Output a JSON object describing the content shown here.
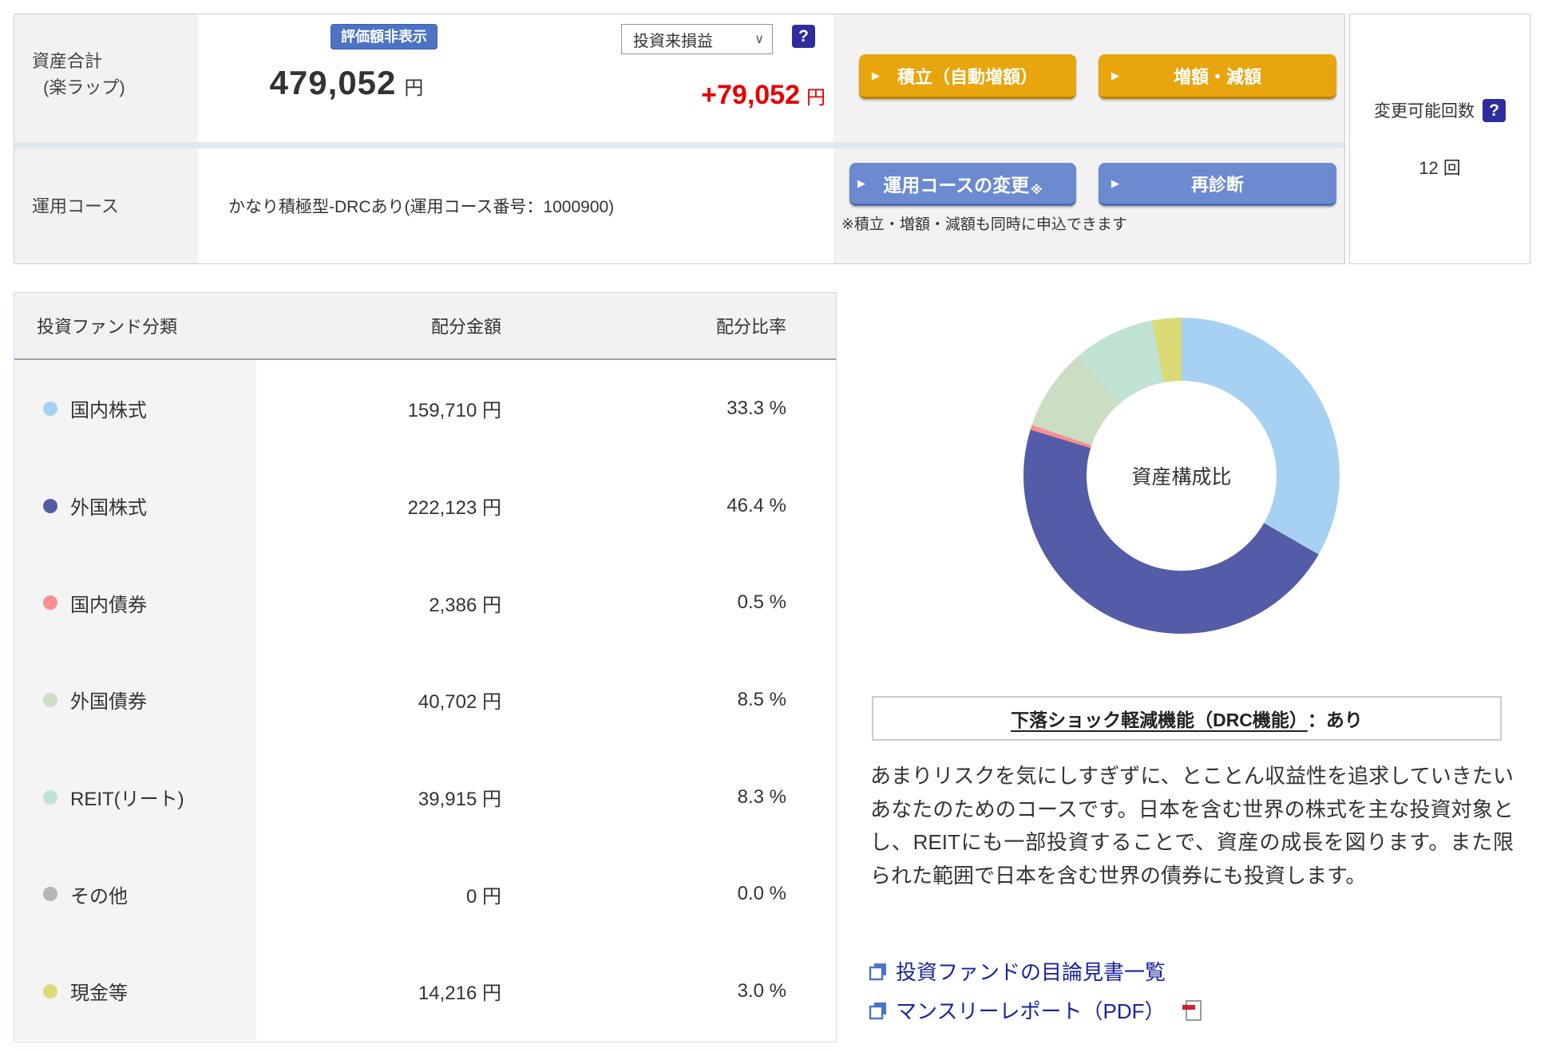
{
  "summary": {
    "asset_label": "資産合計",
    "asset_sublabel": "(楽ラップ)",
    "hide_badge": "評価額非表示",
    "total_value": "479,052",
    "total_unit": "円",
    "period_select_value": "投資来損益",
    "profit_value": "+79,052",
    "profit_unit": "円",
    "tsumitate_button": "積立（自動増額）",
    "zougaku_button": "増額・減額",
    "course_label": "運用コース",
    "course_value": "かなり積極型-DRCあり(運用コース番号：1000900)",
    "course_change_button": "運用コースの変更",
    "course_change_mark": "※",
    "rediagnosis_button": "再診断",
    "note": "※積立・増額・減額も同時に申込できます",
    "change_count_label": "変更可能回数",
    "change_count_value": "12 回"
  },
  "allocation": {
    "headers": {
      "category": "投資ファンド分類",
      "amount": "配分金額",
      "ratio": "配分比率"
    },
    "rows": [
      {
        "label": "国内株式",
        "amount": "159,710 円",
        "ratio": "33.3 %",
        "percent": 33.3,
        "color": "#a7d1f2"
      },
      {
        "label": "外国株式",
        "amount": "222,123 円",
        "ratio": "46.4 %",
        "percent": 46.4,
        "color": "#545ca8"
      },
      {
        "label": "国内債券",
        "amount": "2,386 円",
        "ratio": "0.5 %",
        "percent": 0.5,
        "color": "#f9908f"
      },
      {
        "label": "外国債券",
        "amount": "40,702 円",
        "ratio": "8.5 %",
        "percent": 8.5,
        "color": "#cbdec3"
      },
      {
        "label": "REIT(リート)",
        "amount": "39,915 円",
        "ratio": "8.3 %",
        "percent": 8.3,
        "color": "#bfe2d2"
      },
      {
        "label": "その他",
        "amount": "0 円",
        "ratio": "0.0 %",
        "percent": 0.0,
        "color": "#b5b5b5"
      },
      {
        "label": "現金等",
        "amount": "14,216 円",
        "ratio": "3.0 %",
        "percent": 3.0,
        "color": "#dcd977"
      }
    ]
  },
  "chart": {
    "center_label": "資産構成比"
  },
  "chart_data": {
    "type": "pie",
    "title": "資産構成比",
    "categories": [
      "国内株式",
      "外国株式",
      "国内債券",
      "外国債券",
      "REIT(リート)",
      "その他",
      "現金等"
    ],
    "values": [
      33.3,
      46.4,
      0.5,
      8.5,
      8.3,
      0.0,
      3.0
    ],
    "amounts_jpy": [
      159710,
      222123,
      2386,
      40702,
      39915,
      0,
      14216
    ],
    "colors": [
      "#a7d1f2",
      "#545ca8",
      "#f9908f",
      "#cbdec3",
      "#bfe2d2",
      "#b5b5b5",
      "#dcd977"
    ],
    "donut": true,
    "start_angle_deg": 0,
    "direction": "clockwise"
  },
  "drc": {
    "title_underlined": "下落ショック軽減機能（DRC機能）",
    "title_suffix": "：あり",
    "description": "あまりリスクを気にしすぎずに、とことん収益性を追求していきたいあなたのためのコースです。日本を含む世界の株式を主な投資対象とし、REITにも一部投資することで、資産の成長を図ります。また限られた範囲で日本を含む世界の債券にも投資します。"
  },
  "links": [
    {
      "label": "投資ファンドの目論見書一覧"
    },
    {
      "label": "マンスリーレポート（PDF）"
    }
  ]
}
